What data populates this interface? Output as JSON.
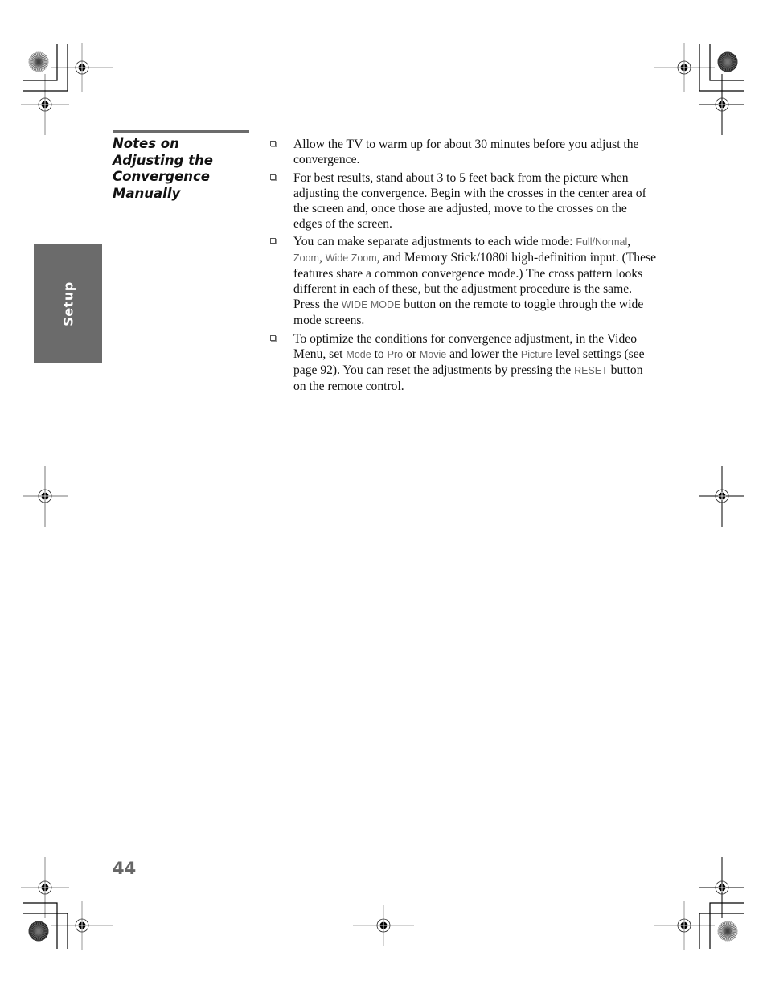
{
  "section": {
    "heading_lines": [
      "Notes on",
      "Adjusting the",
      "Convergence",
      "Manually"
    ],
    "side_tab": "Setup",
    "page_number": "44"
  },
  "notes": [
    {
      "parts": [
        {
          "t": "text",
          "v": "Allow the TV to warm up for about 30 minutes before you adjust the convergence."
        }
      ]
    },
    {
      "parts": [
        {
          "t": "text",
          "v": "For best results, stand about 3 to 5 feet back from the picture when adjusting the convergence. Begin with the crosses in the center area of the screen and, once those are adjusted, move to the crosses on the edges of the screen."
        }
      ]
    },
    {
      "parts": [
        {
          "t": "text",
          "v": "You can make separate adjustments to each wide mode: "
        },
        {
          "t": "ui",
          "v": "Full/Normal"
        },
        {
          "t": "text",
          "v": ", "
        },
        {
          "t": "ui",
          "v": "Zoom"
        },
        {
          "t": "text",
          "v": ", "
        },
        {
          "t": "ui",
          "v": "Wide Zoom"
        },
        {
          "t": "text",
          "v": ", and Memory Stick/1080i high-definition input. (These features share a common convergence mode.) The cross pattern looks different in each of these, but the adjustment procedure is the same. Press the "
        },
        {
          "t": "ui",
          "v": "WIDE MODE"
        },
        {
          "t": "text",
          "v": " button on the remote to toggle through the wide mode screens."
        }
      ]
    },
    {
      "parts": [
        {
          "t": "text",
          "v": "To optimize the conditions for convergence adjustment, in the Video Menu, set "
        },
        {
          "t": "ui",
          "v": "Mode"
        },
        {
          "t": "text",
          "v": " to "
        },
        {
          "t": "ui",
          "v": "Pro"
        },
        {
          "t": "text",
          "v": " or "
        },
        {
          "t": "ui",
          "v": "Movie"
        },
        {
          "t": "text",
          "v": " and lower the "
        },
        {
          "t": "ui",
          "v": "Picture"
        },
        {
          "t": "text",
          "v": " level settings (see page 92). You can reset the adjustments by pressing the "
        },
        {
          "t": "ui",
          "v": "RESET"
        },
        {
          "t": "text",
          "v": " button on the remote control."
        }
      ]
    }
  ],
  "colors": {
    "accent_gray": "#6b6b6b",
    "ui_term_gray": "#666666"
  }
}
